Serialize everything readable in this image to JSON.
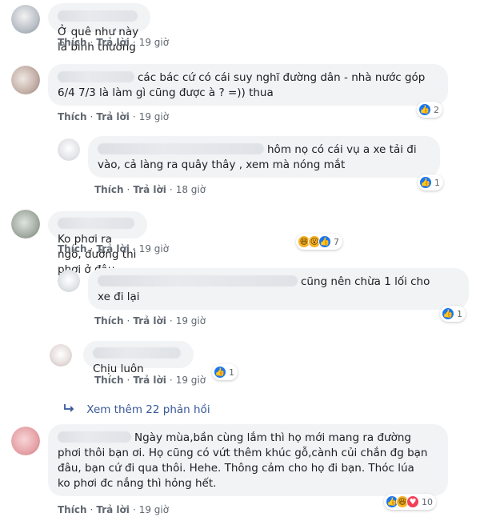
{
  "comments": [
    {
      "text": "Ở quê như này là bình thường",
      "time": "19 giờ",
      "like": "Thích",
      "reply": "Trả lời"
    },
    {
      "text_line1": "các bác cứ có cái suy nghĩ đường dân - nhà nước góp",
      "text_line2": "6/4 7/3 là làm gì cũng được à ? =)) thua",
      "time": "19 giờ",
      "like": "Thích",
      "reply": "Trả lời",
      "reaction_count": "2"
    },
    {
      "text_line1": "hôm nọ có cái vụ a xe tải đi",
      "text_line2": "vào, cả làng ra quây thây , xem mà nóng mắt",
      "time": "18 giờ",
      "like": "Thích",
      "reply": "Trả lời",
      "reaction_count": "1"
    },
    {
      "text": "Ko phơi ra ngõ, đường thì phơi ở đâu",
      "time": "19 giờ",
      "like": "Thích",
      "reply": "Trả lời",
      "reaction_count": "7"
    },
    {
      "text_line1": "cũng nên chừa 1 lối cho",
      "text_line2": "xe đi lại",
      "time": "19 giờ",
      "like": "Thích",
      "reply": "Trả lời",
      "reaction_count": "1"
    },
    {
      "text": "Chịu luôn",
      "time": "19 giờ",
      "like": "Thích",
      "reply": "Trả lời",
      "reaction_count": "1"
    },
    {
      "text_line1": "Ngày mùa,bần cùng lắm thì họ mới mang ra đường",
      "text_line2": "phơi thôi bạn ơi. Họ cũng có vứt thêm khúc gỗ,cành củi chắn đg bạn",
      "text_line3": "đâu, bạn cứ đi qua thôi. Hehe. Thông cảm cho họ đi bạn. Thóc lúa",
      "text_line4": "ko phơi đc nắng thì hỏng hết.",
      "time": "19 giờ",
      "like": "Thích",
      "reply": "Trả lời",
      "reaction_count": "10"
    }
  ],
  "more_replies": "Xem thêm 22 phản hồi",
  "icons": {
    "like": "like-icon",
    "haha": "haha-icon",
    "wow": "wow-icon",
    "love": "love-icon",
    "arrow": "reply-arrow-icon"
  },
  "colors": {
    "bubble": "#f2f3f5",
    "link": "#385898",
    "like_blue": "#1877f2",
    "meta": "#606770"
  }
}
